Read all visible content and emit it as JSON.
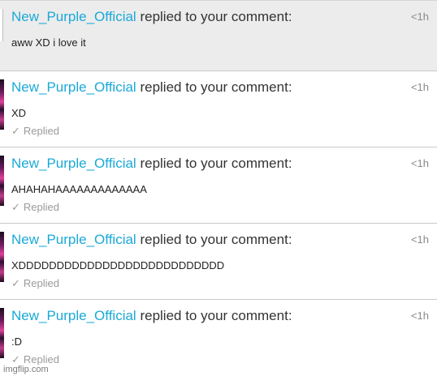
{
  "notifications": [
    {
      "user": "New_Purple_Official",
      "action": "replied to your comment:",
      "time": "<1h",
      "message": "aww XD i love it",
      "replied": ""
    },
    {
      "user": "New_Purple_Official",
      "action": "replied to your comment:",
      "time": "<1h",
      "message": "XD",
      "replied": "Replied"
    },
    {
      "user": "New_Purple_Official",
      "action": "replied to your comment:",
      "time": "<1h",
      "message": "AHAHAHAAAAAAAAAAAAA",
      "replied": "Replied"
    },
    {
      "user": "New_Purple_Official",
      "action": "replied to your comment:",
      "time": "<1h",
      "message": "XDDDDDDDDDDDDDDDDDDDDDDDDDDD",
      "replied": "Replied"
    },
    {
      "user": "New_Purple_Official",
      "action": "replied to your comment:",
      "time": "<1h",
      "message": ":D",
      "replied": "Replied"
    }
  ],
  "icons": {
    "check": "✓"
  },
  "watermark": "imgflip.com",
  "colors": {
    "username": "#1aa9d8",
    "highlight_bg": "#ececec"
  }
}
